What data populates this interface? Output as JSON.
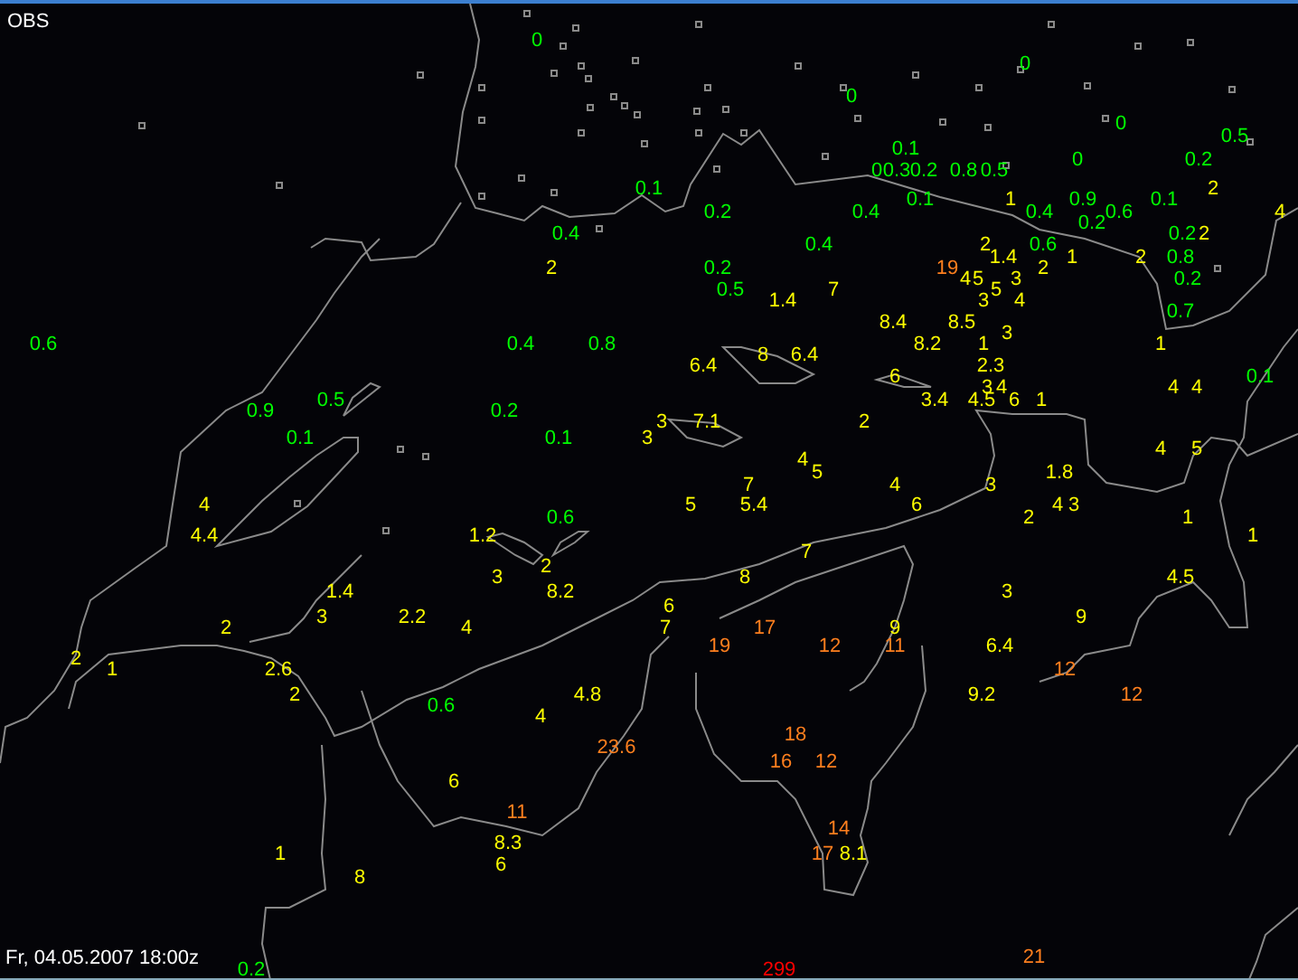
{
  "title": "OBS",
  "timestamp": "Fr, 04.05.2007 18:00z",
  "stations": [
    {
      "value": "0",
      "color": "#00ff00"
    },
    {
      "value": "0",
      "color": "#00ff00"
    },
    {
      "value": "0",
      "color": "#00ff00"
    },
    {
      "value": "0",
      "color": "#00ff00"
    },
    {
      "value": "0.5",
      "color": "#00ff00"
    },
    {
      "value": "0.1",
      "color": "#00ff00"
    },
    {
      "value": "0",
      "color": "#00ff00"
    },
    {
      "value": "0.2",
      "color": "#00ff00"
    },
    {
      "value": "0",
      "color": "#00ff00"
    },
    {
      "value": "0.3",
      "color": "#00ff00"
    },
    {
      "value": "0.2",
      "color": "#00ff00"
    },
    {
      "value": "0.8",
      "color": "#00ff00"
    },
    {
      "value": "0.5",
      "color": "#00ff00"
    },
    {
      "value": "0.1",
      "color": "#00ff00"
    },
    {
      "value": "2",
      "color": "#ffff00"
    },
    {
      "value": "0.1",
      "color": "#00ff00"
    },
    {
      "value": "1",
      "color": "#ffff00"
    },
    {
      "value": "0.9",
      "color": "#00ff00"
    },
    {
      "value": "0.1",
      "color": "#00ff00"
    },
    {
      "value": "0.2",
      "color": "#00ff00"
    },
    {
      "value": "0.4",
      "color": "#00ff00"
    },
    {
      "value": "0.4",
      "color": "#00ff00"
    },
    {
      "value": "0.6",
      "color": "#00ff00"
    },
    {
      "value": "4",
      "color": "#ffff00"
    },
    {
      "value": "0.2",
      "color": "#00ff00"
    },
    {
      "value": "0.4",
      "color": "#00ff00"
    },
    {
      "value": "0.2",
      "color": "#00ff00"
    },
    {
      "value": "2",
      "color": "#ffff00"
    },
    {
      "value": "0.4",
      "color": "#00ff00"
    },
    {
      "value": "2",
      "color": "#ffff00"
    },
    {
      "value": "0.6",
      "color": "#00ff00"
    },
    {
      "value": "1.4",
      "color": "#ffff00"
    },
    {
      "value": "1",
      "color": "#ffff00"
    },
    {
      "value": "2",
      "color": "#ffff00"
    },
    {
      "value": "0.8",
      "color": "#00ff00"
    },
    {
      "value": "2",
      "color": "#ffff00"
    },
    {
      "value": "0.2",
      "color": "#00ff00"
    },
    {
      "value": "19",
      "color": "#ff7f1e"
    },
    {
      "value": "2",
      "color": "#ffff00"
    },
    {
      "value": "4",
      "color": "#ffff00"
    },
    {
      "value": "5",
      "color": "#ffff00"
    },
    {
      "value": "3",
      "color": "#ffff00"
    },
    {
      "value": "0.2",
      "color": "#00ff00"
    },
    {
      "value": "0.5",
      "color": "#00ff00"
    },
    {
      "value": "7",
      "color": "#ffff00"
    },
    {
      "value": "5",
      "color": "#ffff00"
    },
    {
      "value": "1.4",
      "color": "#ffff00"
    },
    {
      "value": "3",
      "color": "#ffff00"
    },
    {
      "value": "4",
      "color": "#ffff00"
    },
    {
      "value": "0.7",
      "color": "#00ff00"
    },
    {
      "value": "8.4",
      "color": "#ffff00"
    },
    {
      "value": "8.5",
      "color": "#ffff00"
    },
    {
      "value": "3",
      "color": "#ffff00"
    },
    {
      "value": "0.6",
      "color": "#00ff00"
    },
    {
      "value": "0.4",
      "color": "#00ff00"
    },
    {
      "value": "0.8",
      "color": "#00ff00"
    },
    {
      "value": "8.2",
      "color": "#ffff00"
    },
    {
      "value": "1",
      "color": "#ffff00"
    },
    {
      "value": "1",
      "color": "#ffff00"
    },
    {
      "value": "8",
      "color": "#ffff00"
    },
    {
      "value": "6.4",
      "color": "#ffff00"
    },
    {
      "value": "6.4",
      "color": "#ffff00"
    },
    {
      "value": "2.3",
      "color": "#ffff00"
    },
    {
      "value": "6",
      "color": "#ffff00"
    },
    {
      "value": "0.1",
      "color": "#00ff00"
    },
    {
      "value": "3",
      "color": "#ffff00"
    },
    {
      "value": "4",
      "color": "#ffff00"
    },
    {
      "value": "4",
      "color": "#ffff00"
    },
    {
      "value": "4",
      "color": "#ffff00"
    },
    {
      "value": "0.5",
      "color": "#00ff00"
    },
    {
      "value": "3.4",
      "color": "#ffff00"
    },
    {
      "value": "4.5",
      "color": "#ffff00"
    },
    {
      "value": "6",
      "color": "#ffff00"
    },
    {
      "value": "1",
      "color": "#ffff00"
    },
    {
      "value": "0.9",
      "color": "#00ff00"
    },
    {
      "value": "0.2",
      "color": "#00ff00"
    },
    {
      "value": "3",
      "color": "#ffff00"
    },
    {
      "value": "7.1",
      "color": "#ffff00"
    },
    {
      "value": "2",
      "color": "#ffff00"
    },
    {
      "value": "0.1",
      "color": "#00ff00"
    },
    {
      "value": "0.1",
      "color": "#00ff00"
    },
    {
      "value": "3",
      "color": "#ffff00"
    },
    {
      "value": "4",
      "color": "#ffff00"
    },
    {
      "value": "5",
      "color": "#ffff00"
    },
    {
      "value": "4",
      "color": "#ffff00"
    },
    {
      "value": "5",
      "color": "#ffff00"
    },
    {
      "value": "1.8",
      "color": "#ffff00"
    },
    {
      "value": "7",
      "color": "#ffff00"
    },
    {
      "value": "4",
      "color": "#ffff00"
    },
    {
      "value": "3",
      "color": "#ffff00"
    },
    {
      "value": "4",
      "color": "#ffff00"
    },
    {
      "value": "5",
      "color": "#ffff00"
    },
    {
      "value": "5.4",
      "color": "#ffff00"
    },
    {
      "value": "6",
      "color": "#ffff00"
    },
    {
      "value": "4",
      "color": "#ffff00"
    },
    {
      "value": "3",
      "color": "#ffff00"
    },
    {
      "value": "0.6",
      "color": "#00ff00"
    },
    {
      "value": "2",
      "color": "#ffff00"
    },
    {
      "value": "1",
      "color": "#ffff00"
    },
    {
      "value": "4.4",
      "color": "#ffff00"
    },
    {
      "value": "1.2",
      "color": "#ffff00"
    },
    {
      "value": "1",
      "color": "#ffff00"
    },
    {
      "value": "7",
      "color": "#ffff00"
    },
    {
      "value": "2",
      "color": "#ffff00"
    },
    {
      "value": "3",
      "color": "#ffff00"
    },
    {
      "value": "8",
      "color": "#ffff00"
    },
    {
      "value": "4.5",
      "color": "#ffff00"
    },
    {
      "value": "1.4",
      "color": "#ffff00"
    },
    {
      "value": "8.2",
      "color": "#ffff00"
    },
    {
      "value": "3",
      "color": "#ffff00"
    },
    {
      "value": "6",
      "color": "#ffff00"
    },
    {
      "value": "3",
      "color": "#ffff00"
    },
    {
      "value": "2.2",
      "color": "#ffff00"
    },
    {
      "value": "9",
      "color": "#ffff00"
    },
    {
      "value": "2",
      "color": "#ffff00"
    },
    {
      "value": "4",
      "color": "#ffff00"
    },
    {
      "value": "7",
      "color": "#ffff00"
    },
    {
      "value": "17",
      "color": "#ff7f1e"
    },
    {
      "value": "9",
      "color": "#ffff00"
    },
    {
      "value": "19",
      "color": "#ff7f1e"
    },
    {
      "value": "12",
      "color": "#ff7f1e"
    },
    {
      "value": "11",
      "color": "#ff7f1e"
    },
    {
      "value": "6.4",
      "color": "#ffff00"
    },
    {
      "value": "2",
      "color": "#ffff00"
    },
    {
      "value": "1",
      "color": "#ffff00"
    },
    {
      "value": "2.6",
      "color": "#ffff00"
    },
    {
      "value": "12",
      "color": "#ff7f1e"
    },
    {
      "value": "2",
      "color": "#ffff00"
    },
    {
      "value": "4.8",
      "color": "#ffff00"
    },
    {
      "value": "9.2",
      "color": "#ffff00"
    },
    {
      "value": "12",
      "color": "#ff7f1e"
    },
    {
      "value": "0.6",
      "color": "#00ff00"
    },
    {
      "value": "4",
      "color": "#ffff00"
    },
    {
      "value": "18",
      "color": "#ff7f1e"
    },
    {
      "value": "23.6",
      "color": "#ff7f1e"
    },
    {
      "value": "16",
      "color": "#ff7f1e"
    },
    {
      "value": "12",
      "color": "#ff7f1e"
    },
    {
      "value": "6",
      "color": "#ffff00"
    },
    {
      "value": "11",
      "color": "#ff7f1e"
    },
    {
      "value": "14",
      "color": "#ff7f1e"
    },
    {
      "value": "8.3",
      "color": "#ffff00"
    },
    {
      "value": "1",
      "color": "#ffff00"
    },
    {
      "value": "17",
      "color": "#ff7f1e"
    },
    {
      "value": "8.1",
      "color": "#ffff00"
    },
    {
      "value": "6",
      "color": "#ffff00"
    },
    {
      "value": "8",
      "color": "#ffff00"
    },
    {
      "value": "21",
      "color": "#ff7f1e"
    },
    {
      "value": "0.2",
      "color": "#00ff00"
    },
    {
      "value": "299",
      "color": "#ff0000"
    }
  ]
}
